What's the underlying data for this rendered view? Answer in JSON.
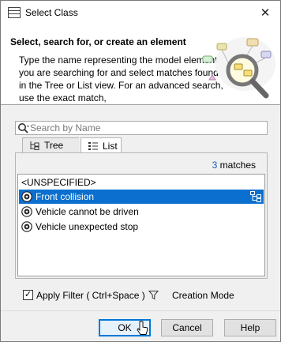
{
  "window": {
    "title": "Select Class",
    "close_glyph": "✕"
  },
  "header": {
    "title": "Select, search for, or create an element",
    "description": "Type the name representing the model element you are searching for and select matches found in the Tree or List view. For an advanced search, use the exact match,"
  },
  "search": {
    "placeholder": "Search by Name",
    "value": ""
  },
  "tabs": [
    {
      "label": "Tree",
      "icon": "tree-icon",
      "active": false
    },
    {
      "label": "List",
      "icon": "list-icon",
      "active": true
    }
  ],
  "results": {
    "count": "3",
    "count_suffix": " matches",
    "items": [
      {
        "label": "<UNSPECIFIED>",
        "icon": "",
        "selected": false
      },
      {
        "label": "Front collision",
        "icon": "class-icon",
        "selected": true
      },
      {
        "label": "Vehicle cannot be driven",
        "icon": "class-icon",
        "selected": false
      },
      {
        "label": "Vehicle unexpected stop",
        "icon": "class-icon",
        "selected": false
      }
    ]
  },
  "filter": {
    "checked": true,
    "check_glyph": "✓",
    "label": "Apply Filter ( Ctrl+Space )",
    "creation_mode": "Creation Mode"
  },
  "buttons": {
    "ok": "OK",
    "cancel": "Cancel",
    "help": "Help"
  },
  "colors": {
    "selection": "#0a6fcf",
    "accent": "#0078d7",
    "count": "#1a5fb4"
  }
}
